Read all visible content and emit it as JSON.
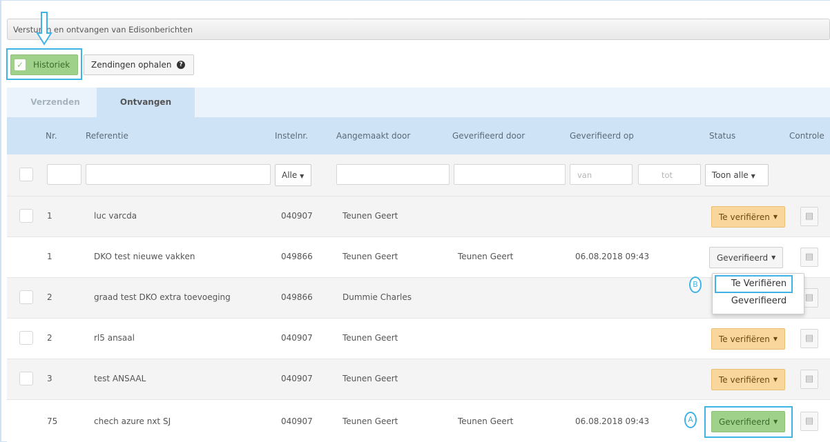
{
  "window": {
    "title": "Versturen en ontvangen van Edisonberichten"
  },
  "toolbar": {
    "historiek_label": "Historiek",
    "zendingen_label": "Zendingen ophalen"
  },
  "tabs": [
    {
      "label": "Verzenden",
      "active": false
    },
    {
      "label": "Ontvangen",
      "active": true
    }
  ],
  "table": {
    "columns": [
      "Nr.",
      "Referentie",
      "Instelnr.",
      "Aangemaakt door",
      "Geverifieerd door",
      "Geverifieerd op",
      "Status",
      "Controle"
    ],
    "filters": {
      "instelnr_select": "Alle",
      "date_from_placeholder": "van",
      "date_to_placeholder": "tot",
      "status_select": "Toon alle"
    },
    "rows": [
      {
        "nr": "1",
        "referentie": "luc varcda",
        "instelnr": "040907",
        "aangemaakt": "Teunen Geert",
        "geverifieerd_door": "",
        "geverifieerd_op": "",
        "status": "Te verifiëren"
      },
      {
        "nr": "1",
        "referentie": "DKO test nieuwe vakken",
        "instelnr": "049866",
        "aangemaakt": "Teunen Geert",
        "geverifieerd_door": "Teunen Geert",
        "geverifieerd_op": "06.08.2018 09:43",
        "status": "Geverifieerd"
      },
      {
        "nr": "2",
        "referentie": "graad test DKO extra toevoeging",
        "instelnr": "049866",
        "aangemaakt": "Dummie Charles",
        "geverifieerd_door": "",
        "geverifieerd_op": "",
        "status": ""
      },
      {
        "nr": "2",
        "referentie": "rl5 ansaal",
        "instelnr": "040907",
        "aangemaakt": "Teunen Geert",
        "geverifieerd_door": "",
        "geverifieerd_op": "",
        "status": "Te verifiëren"
      },
      {
        "nr": "3",
        "referentie": "test ANSAAL",
        "instelnr": "040907",
        "aangemaakt": "Teunen Geert",
        "geverifieerd_door": "",
        "geverifieerd_op": "",
        "status": "Te verifiëren"
      },
      {
        "nr": "75",
        "referentie": "chech azure nxt SJ",
        "instelnr": "040907",
        "aangemaakt": "Teunen Geert",
        "geverifieerd_door": "Teunen Geert",
        "geverifieerd_op": "06.08.2018 09:43",
        "status": "Geverifieerd"
      }
    ]
  },
  "status_dropdown": {
    "options": [
      "Te Verifiëren",
      "Geverifieerd"
    ]
  },
  "annotations": {
    "marker_a": "A",
    "marker_b": "B"
  },
  "colors": {
    "highlight": "#40b3e6",
    "status_pending": "#f9d69b",
    "status_verified": "#9fd18b",
    "header_bg": "#cfe3f6"
  },
  "icons": {
    "check": "check-icon",
    "help": "question-circle-icon",
    "document": "document-icon",
    "caret": "caret-down-icon",
    "arrow": "down-arrow-icon"
  }
}
